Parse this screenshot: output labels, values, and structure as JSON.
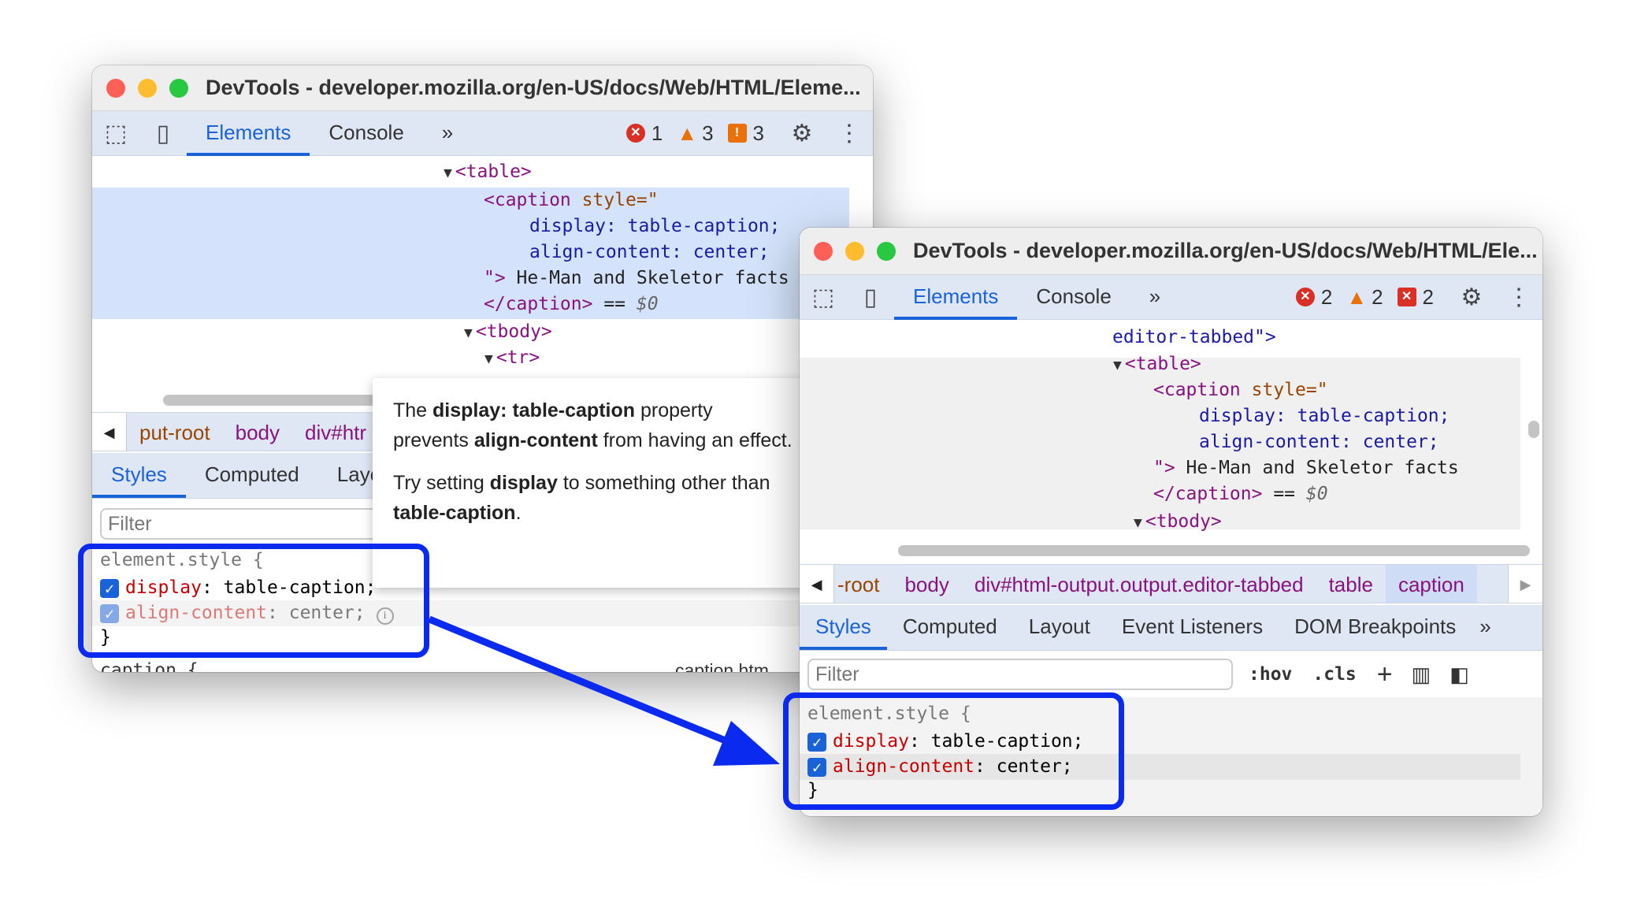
{
  "left": {
    "title": "DevTools - developer.mozilla.org/en-US/docs/Web/HTML/Eleme...",
    "tabs": [
      "Elements",
      "Console"
    ],
    "more": "»",
    "errors": "1",
    "warnings": "3",
    "issues": "3",
    "dom": {
      "table": "<table>",
      "caption_open": "<caption",
      "style_attr": " style=\"",
      "decl1": "display: table-caption;",
      "decl2": "align-content: center;",
      "close_quote": "\">",
      "text": " He-Man and Skeletor facts",
      "caption_close": "</caption>",
      "eq": " == ",
      "dollar": "$0",
      "tbody": "<tbody>",
      "tr": "<tr>"
    },
    "breadcrumbs": [
      "put-root",
      "body",
      "div#htr"
    ],
    "subtabs": [
      "Styles",
      "Computed",
      "Layo"
    ],
    "filter_placeholder": "Filter",
    "rule": {
      "selector": "element.style {",
      "p1": "display",
      "v1": " table-caption;",
      "p2": "align-content",
      "v2": " center;",
      "close": "}",
      "next": "caption {",
      "next_src": "caption.htm"
    }
  },
  "tooltip": {
    "l1a": "The ",
    "l1b": "display: table-caption",
    "l1c": " property prevents ",
    "l1d": "align-content",
    "l1e": " from having an effect.",
    "l2a": "Try setting ",
    "l2b": "display",
    "l2c": " to something other than ",
    "l2d": "table-caption",
    "l2e": "."
  },
  "right": {
    "title": "DevTools - developer.mozilla.org/en-US/docs/Web/HTML/Ele...",
    "tabs": [
      "Elements",
      "Console"
    ],
    "more": "»",
    "errors": "2",
    "warnings": "2",
    "issues": "2",
    "dom": {
      "editor": "editor-tabbed\">",
      "table": "<table>",
      "caption_open": "<caption",
      "style_attr": " style=\"",
      "decl1": "display: table-caption;",
      "decl2": "align-content: center;",
      "close_quote": "\">",
      "text": " He-Man and Skeletor facts",
      "caption_close": "</caption>",
      "eq": " == ",
      "dollar": "$0",
      "tbody": "<tbody>"
    },
    "breadcrumbs": [
      "-root",
      "body",
      "div#html-output.output.editor-tabbed",
      "table",
      "caption"
    ],
    "subtabs": [
      "Styles",
      "Computed",
      "Layout",
      "Event Listeners",
      "DOM Breakpoints"
    ],
    "filter_placeholder": "Filter",
    "hov": ":hov",
    "cls": ".cls",
    "rule": {
      "selector": "element.style {",
      "p1": "display",
      "v1": " table-caption;",
      "p2": "align-content",
      "v2": " center;",
      "close": "}"
    }
  },
  "colors": {
    "accent": "#1a62d8",
    "highlight_box": "#0b2af0",
    "error": "#d93025",
    "warning": "#e8710a"
  }
}
